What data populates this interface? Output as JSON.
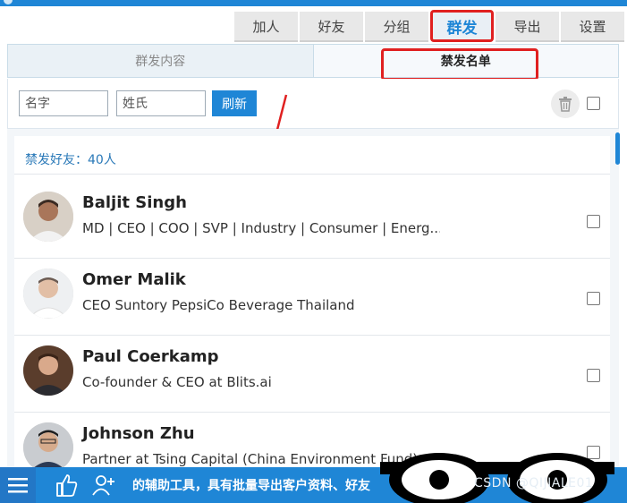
{
  "toptabs": [
    {
      "label": "加人"
    },
    {
      "label": "好友"
    },
    {
      "label": "分组"
    },
    {
      "label": "群发"
    },
    {
      "label": "导出"
    },
    {
      "label": "设置"
    }
  ],
  "active_toptab": "群发",
  "subtabs": {
    "content": "群发内容",
    "blocklist": "禁发名单"
  },
  "toolbar": {
    "first_name_placeholder": "名字",
    "last_name_placeholder": "姓氏",
    "refresh_label": "刷新",
    "trash_icon": "trash-icon"
  },
  "list": {
    "count_label": "禁发好友：40人",
    "items": [
      {
        "name": "Baljit Singh",
        "headline": "MD | CEO | COO | SVP | Industry | Consumer | Energ..."
      },
      {
        "name": "Omer Malik",
        "headline": "CEO Suntory PepsiCo Beverage Thailand"
      },
      {
        "name": "Paul Coerkamp",
        "headline": "Co-founder & CEO at Blits.ai"
      },
      {
        "name": "Johnson Zhu",
        "headline": "Partner at Tsing Capital (China Environment Fund)"
      }
    ]
  },
  "bottombar": {
    "marquee": "的辅助工具，具有批量导出客户资料、好友"
  },
  "watermark": "CSDN @QIJIALE01",
  "colors": {
    "accent": "#1f86d6",
    "highlight": "#e02020"
  }
}
